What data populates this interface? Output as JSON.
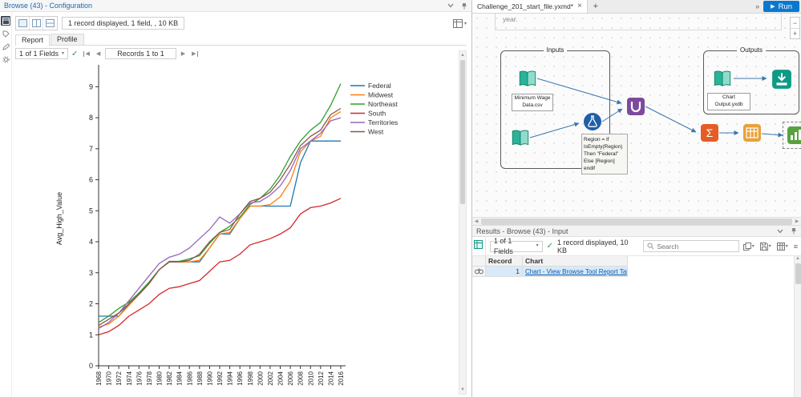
{
  "colors": {
    "accent_blue": "#0a78cf",
    "header_text": "#2068b0",
    "link": "#0a5cb0",
    "check_green": "#2f9e44"
  },
  "icons": {
    "caret_down": "▾",
    "close": "×",
    "add": "+",
    "overflow": "»",
    "play": "▶",
    "prev": "◀",
    "next": "▶",
    "check": "✓",
    "menu": "≡",
    "minus": "−",
    "plus": "+",
    "up": "▲",
    "down": "▼",
    "left": "◀",
    "right": "▶"
  },
  "config_panel": {
    "title": "Browse (43) - Configuration",
    "summary": "1 record displayed, 1 field, , 10 KB",
    "tabs": [
      "Report",
      "Profile"
    ],
    "fields_dropdown": "1 of 1 Fields",
    "records_box": "Records 1 to 1"
  },
  "canvas": {
    "tab_title": "Challenge_201_start_file.yxmd*",
    "run_label": "Run",
    "comment_fragment": "year.",
    "inputs_container": {
      "label": "Inputs",
      "file_label_lines": [
        "Minimum Wage",
        "Data.csv"
      ]
    },
    "outputs_container": {
      "label": "Outputs",
      "file_label_lines": [
        "Chart",
        "Output.yxdb"
      ]
    },
    "annotation_lines": [
      "Region = If",
      "IsEmpty(Region)",
      "Then \"Federal\"",
      "Else [Region]",
      "endif"
    ]
  },
  "results_panel": {
    "title": "Results - Browse (43) - Input",
    "fields_dropdown": "1 of 1 Fields",
    "summary": "1 record displayed, 10 KB",
    "search_placeholder": "Search",
    "columns": [
      "Record",
      "Chart"
    ],
    "rows": [
      {
        "record": "1",
        "chart": "Chart - View Browse Tool Report Tab"
      }
    ]
  },
  "chart_data": {
    "type": "line",
    "title": "",
    "xlabel": "",
    "ylabel": "Avg_High_Value",
    "ylim": [
      0,
      9.5
    ],
    "yticks": [
      0,
      1,
      2,
      3,
      4,
      5,
      6,
      7,
      8,
      9
    ],
    "grid": false,
    "legend_position": "top-right",
    "x": [
      1968,
      1970,
      1972,
      1974,
      1976,
      1978,
      1980,
      1982,
      1984,
      1986,
      1988,
      1990,
      1992,
      1994,
      1996,
      1998,
      2000,
      2002,
      2004,
      2006,
      2008,
      2010,
      2012,
      2014,
      2016
    ],
    "series": [
      {
        "name": "Federal",
        "color": "#1f77b4",
        "values": [
          1.6,
          1.6,
          1.6,
          2.0,
          2.3,
          2.65,
          3.1,
          3.35,
          3.35,
          3.35,
          3.35,
          3.8,
          4.25,
          4.25,
          4.75,
          5.15,
          5.15,
          5.15,
          5.15,
          5.15,
          6.55,
          7.25,
          7.25,
          7.25,
          7.25
        ]
      },
      {
        "name": "Midwest",
        "color": "#ff7f0e",
        "values": [
          1.25,
          1.35,
          1.6,
          1.95,
          2.3,
          2.65,
          3.1,
          3.35,
          3.35,
          3.35,
          3.4,
          3.8,
          4.25,
          4.3,
          4.75,
          5.15,
          5.15,
          5.2,
          5.45,
          5.95,
          6.9,
          7.25,
          7.4,
          8.0,
          8.2
        ]
      },
      {
        "name": "Northeast",
        "color": "#2ca02c",
        "values": [
          1.4,
          1.6,
          1.85,
          2.05,
          2.35,
          2.7,
          3.1,
          3.37,
          3.37,
          3.45,
          3.55,
          3.95,
          4.3,
          4.5,
          4.8,
          5.2,
          5.4,
          5.7,
          6.15,
          6.75,
          7.25,
          7.6,
          7.85,
          8.4,
          9.1
        ]
      },
      {
        "name": "South",
        "color": "#d62728",
        "values": [
          1.0,
          1.1,
          1.3,
          1.6,
          1.8,
          2.0,
          2.3,
          2.5,
          2.55,
          2.65,
          2.75,
          3.05,
          3.35,
          3.4,
          3.6,
          3.9,
          4.0,
          4.1,
          4.25,
          4.45,
          4.9,
          5.1,
          5.15,
          5.25,
          5.4
        ]
      },
      {
        "name": "Territories",
        "color": "#9467bd",
        "values": [
          1.2,
          1.4,
          1.7,
          2.1,
          2.5,
          2.9,
          3.3,
          3.5,
          3.6,
          3.8,
          4.1,
          4.4,
          4.8,
          4.6,
          4.9,
          5.25,
          5.3,
          5.5,
          5.8,
          6.3,
          7.0,
          7.25,
          7.5,
          7.9,
          8.0
        ]
      },
      {
        "name": "West",
        "color": "#8c564b",
        "values": [
          1.3,
          1.5,
          1.7,
          2.0,
          2.3,
          2.65,
          3.1,
          3.35,
          3.35,
          3.4,
          3.6,
          4.0,
          4.3,
          4.4,
          4.9,
          5.3,
          5.4,
          5.6,
          6.0,
          6.5,
          7.1,
          7.4,
          7.6,
          8.1,
          8.3
        ]
      }
    ]
  }
}
